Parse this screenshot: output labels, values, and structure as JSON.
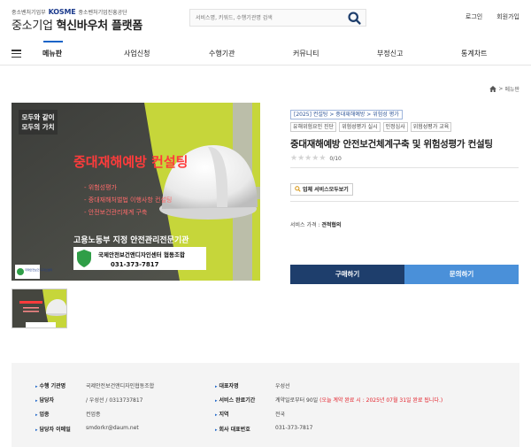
{
  "header": {
    "agency": "중소벤처기업부",
    "kosme": "KOSME",
    "kosme_sub": "중소벤처기업진흥공단",
    "title_light": "중소기업",
    "title_bold": "혁신바우처 플랫폼",
    "search_placeholder": "서비스명, 키워드, 수행기관명 검색",
    "login": "로그인",
    "signup": "회원가입"
  },
  "nav": {
    "items": [
      "메뉴판",
      "사업신청",
      "수행기관",
      "커뮤니티",
      "부정신고",
      "통계차트"
    ]
  },
  "breadcrumb": {
    "current": "메뉴판"
  },
  "product_image": {
    "line1": "모두와 같이",
    "line2": "모두의 가치",
    "headline": "중대재해예방 컨설팅",
    "bullets": [
      "- 위험성평가",
      "- 중대재해처벌법 이행사항 컨설팅",
      "- 안전보건관리체계 구축"
    ],
    "org_line": "고용노동부 지정 안전관리전문기관",
    "org_name": "국제안전보건앤디자인센터 협동조합",
    "org_phone": "031-373-7817",
    "corner_badge": "국제안전보건 디자인센터"
  },
  "info": {
    "category": "[2025] 컨설팅 > 중대재해예방 > 위험성 평가",
    "tags": [
      "유해위험요인 진단",
      "위험성평가 실시",
      "인정심사",
      "위험성평가 교육"
    ],
    "title": "중대재해예방 안전보건체계구축 및 위험성평가 컨설팅",
    "rating_score": "0/10",
    "stars": 5,
    "service_button": "업체 서비스모두보기",
    "price_label": "서비스 가격 :",
    "price_value": "견적협의",
    "buy": "구매하기",
    "inquiry": "문의하기"
  },
  "details": {
    "rows_left": [
      {
        "key": "수행 기관명",
        "value": "국제안전보건앤디자인협동조합"
      },
      {
        "key": "담당자",
        "value": "/ 우성선 / 0313737817"
      },
      {
        "key": "업종",
        "value": "컨업종"
      },
      {
        "key": "담당자 이메일",
        "value": "smdorkr@daum.net"
      }
    ],
    "rows_right": [
      {
        "key": "대표자명",
        "value": "우성선"
      },
      {
        "key": "서비스 완료기간",
        "value": "계약일로부터 90일",
        "note": "(오늘 계약 완료 시 : 2025년 07월 31일 완료 됩니다.)"
      },
      {
        "key": "지역",
        "value": "전국"
      },
      {
        "key": "회사 대표번호",
        "value": "031-373-7817"
      }
    ]
  },
  "colors": {
    "accent": "#1a64c8",
    "buy_button": "#1e3e6c",
    "inquiry_button": "#4a90d9",
    "headline_red": "#e3232c"
  }
}
